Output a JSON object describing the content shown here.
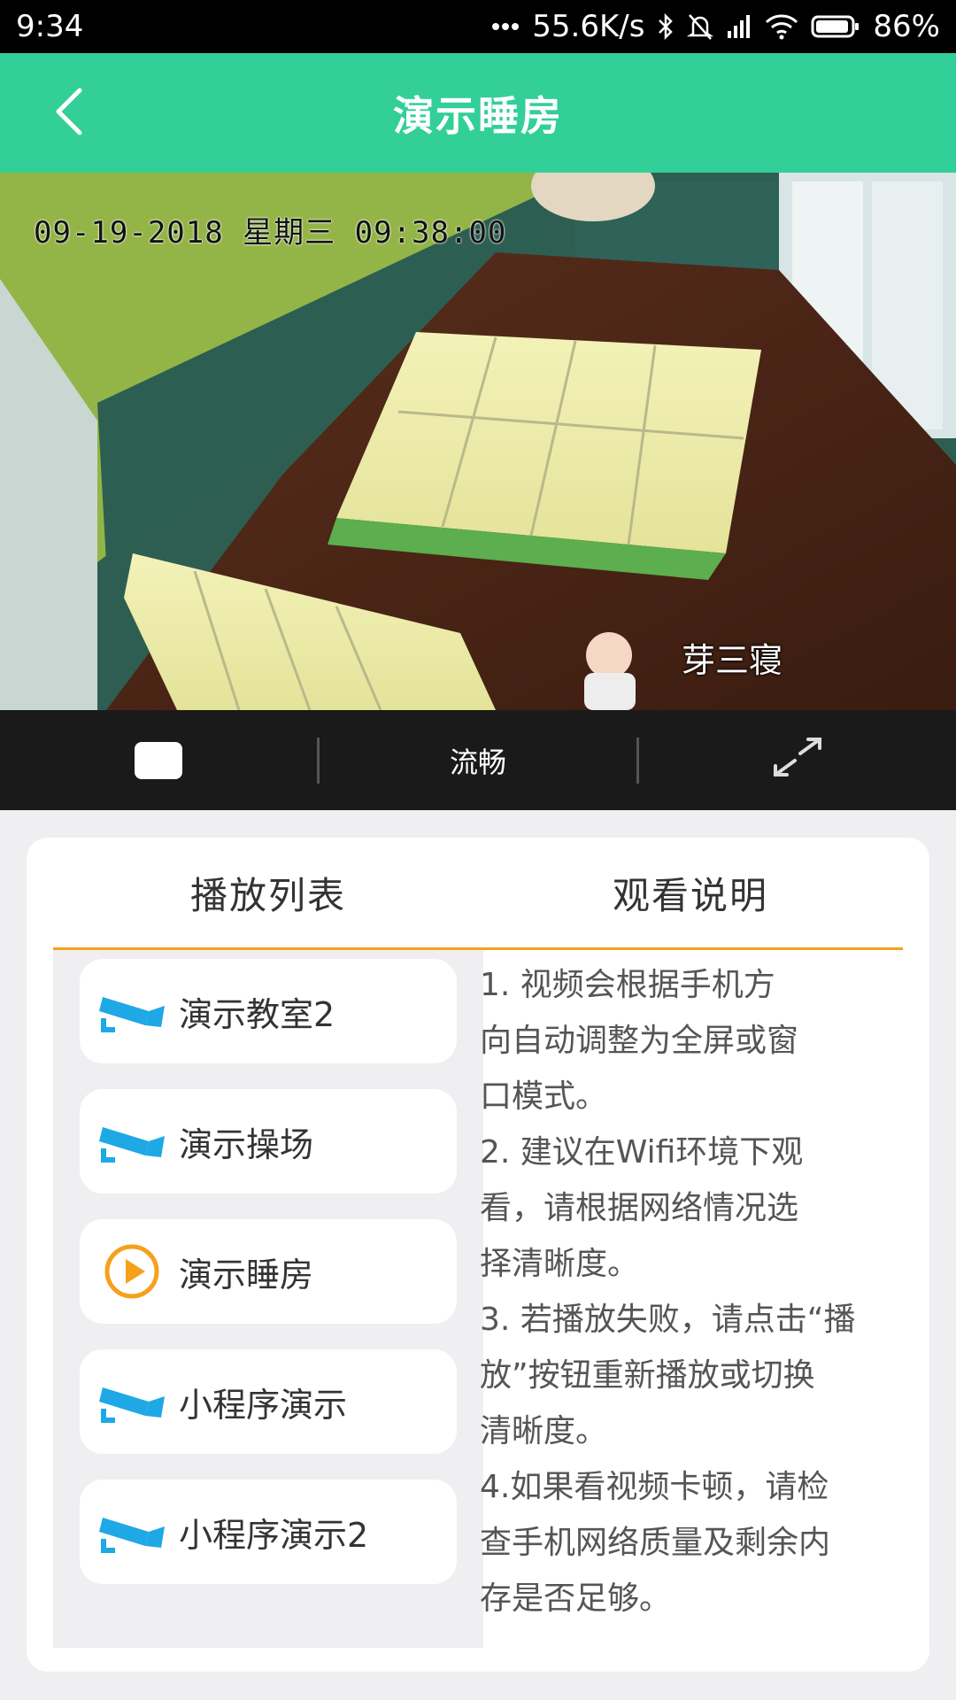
{
  "status_bar": {
    "time": "9:34",
    "network_speed": "55.6K/s",
    "battery": "86%",
    "icons": [
      "more-dots-icon",
      "bluetooth-icon",
      "mute-bell-icon",
      "signal-icon",
      "wifi-icon",
      "battery-icon"
    ]
  },
  "header": {
    "title": "演示睡房",
    "back_icon": "chevron-left-icon",
    "background_color": "#33cf98"
  },
  "video": {
    "timestamp": "09-19-2018 星期三 09:38:00",
    "camera_label": "芽三寝"
  },
  "controls": {
    "play_icon": "stop-icon",
    "quality_label": "流畅",
    "fullscreen_icon": "expand-icon"
  },
  "tabs": {
    "playlist_title": "播放列表",
    "instructions_title": "观看说明",
    "accent_color": "#f5a11c"
  },
  "playlist": [
    {
      "label": "演示教室2",
      "icon": "camera-icon",
      "active": false
    },
    {
      "label": "演示操场",
      "icon": "camera-icon",
      "active": false
    },
    {
      "label": "演示睡房",
      "icon": "play-circle-icon",
      "active": true
    },
    {
      "label": "小程序演示",
      "icon": "camera-icon",
      "active": false
    },
    {
      "label": "小程序演示2",
      "icon": "camera-icon",
      "active": false
    }
  ],
  "instructions": [
    "1. 视频会根据手机方",
    "向自动调整为全屏或窗",
    "口模式。",
    "2. 建议在Wifi环境下观",
    "看，请根据网络情况选",
    "择清晰度。",
    "3. 若播放失败，请点击“播",
    "放”按钮重新播放或切换",
    "清晰度。",
    "4.如果看视频卡顿，请检",
    "查手机网络质量及剩余内",
    "存是否足够。"
  ]
}
